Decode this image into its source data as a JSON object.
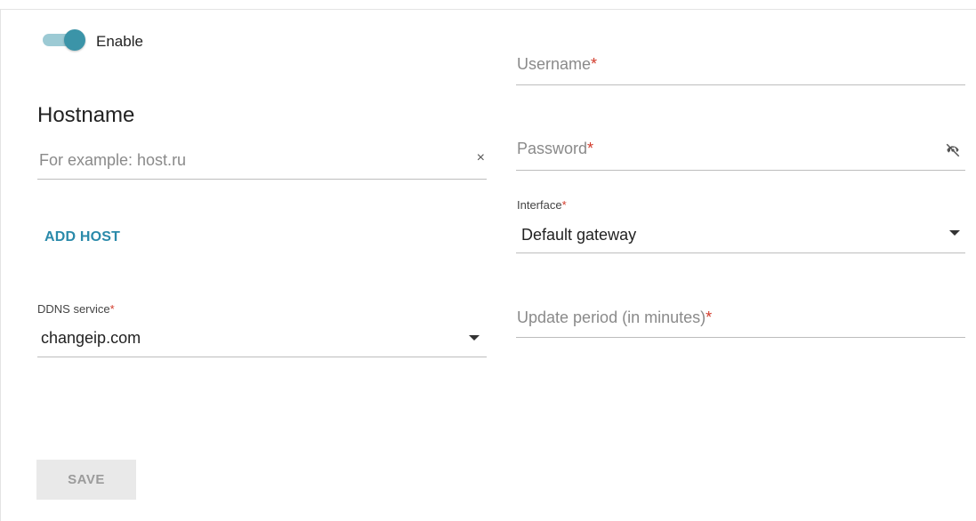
{
  "toggle": {
    "label": "Enable",
    "enabled": true
  },
  "hostname": {
    "title": "Hostname",
    "placeholder": "For example: host.ru",
    "value": "",
    "clear_glyph": "×"
  },
  "add_host": {
    "label": "ADD HOST"
  },
  "ddns": {
    "label": "DDNS service",
    "required_mark": "*",
    "value": "changeip.com"
  },
  "save": {
    "label": "SAVE",
    "disabled": true
  },
  "username": {
    "label": "Username",
    "required_mark": "*"
  },
  "password": {
    "label": "Password",
    "required_mark": "*",
    "icon": "eye-off-icon"
  },
  "interface": {
    "label": "Interface",
    "required_mark": "*",
    "value": "Default gateway"
  },
  "update_period": {
    "label": "Update period (in minutes)",
    "required_mark": "*"
  },
  "colors": {
    "accent": "#2a8aaa",
    "toggle_knob": "#3b94a8",
    "toggle_track": "#9ccad4",
    "required": "#d23b2b",
    "disabled_button_bg": "#e9e9e9"
  }
}
